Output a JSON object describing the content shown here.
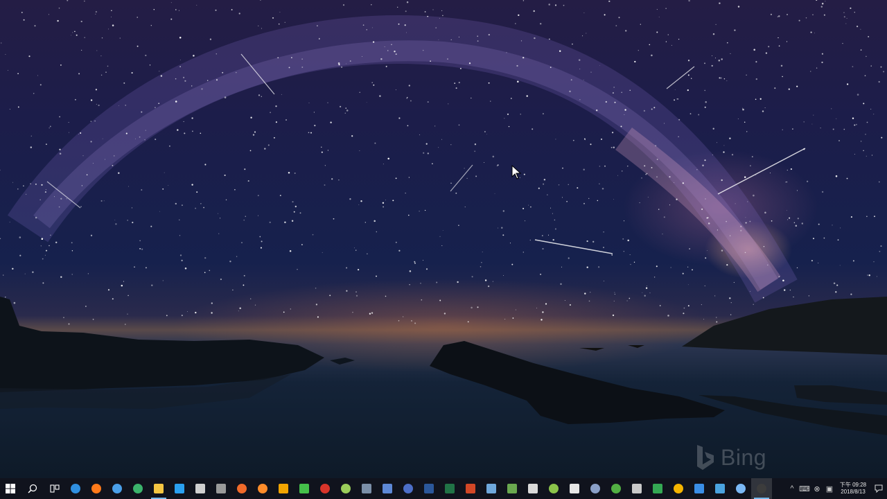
{
  "wallpaper": {
    "description_name": "milky-way-over-sea-wallpaper",
    "watermark_text": "Bing"
  },
  "taskbar": {
    "start": "start-icon",
    "search": "search-icon",
    "task_view": "task-view-icon",
    "apps": [
      {
        "name": "edge-icon",
        "color": "#2f8fe0",
        "shape": "round",
        "running": false
      },
      {
        "name": "firefox-icon",
        "color": "#ff7a1a",
        "shape": "round",
        "running": false
      },
      {
        "name": "chrome-icon",
        "color": "#4a9fe8",
        "shape": "round",
        "running": false
      },
      {
        "name": "colorful-app-icon",
        "color": "#3bb36b",
        "shape": "round",
        "running": false
      },
      {
        "name": "file-explorer-icon",
        "color": "#f4c542",
        "shape": "square",
        "running": true
      },
      {
        "name": "media-player-icon",
        "color": "#2aa0f0",
        "shape": "square",
        "running": false
      },
      {
        "name": "video-editor-icon",
        "color": "#cfcfcf",
        "shape": "square",
        "running": false
      },
      {
        "name": "clapper-icon",
        "color": "#9a9a9a",
        "shape": "square",
        "running": false
      },
      {
        "name": "orange-app-icon",
        "color": "#f06a2a",
        "shape": "round",
        "running": false
      },
      {
        "name": "paint-app-icon",
        "color": "#ff8c2a",
        "shape": "round",
        "running": false
      },
      {
        "name": "yellow-app-icon",
        "color": "#f2a400",
        "shape": "square",
        "running": false
      },
      {
        "name": "notepad-plus-icon",
        "color": "#44c04a",
        "shape": "square",
        "running": false
      },
      {
        "name": "red-circle-icon",
        "color": "#d8342a",
        "shape": "round",
        "running": false
      },
      {
        "name": "green-leaf-icon",
        "color": "#9acd5a",
        "shape": "round",
        "running": false
      },
      {
        "name": "tools-icon",
        "color": "#7b8fa8",
        "shape": "square",
        "running": false
      },
      {
        "name": "remote-desktop-icon",
        "color": "#5d88d6",
        "shape": "square",
        "running": false
      },
      {
        "name": "globe-app-icon",
        "color": "#4c6ec8",
        "shape": "round",
        "running": false
      },
      {
        "name": "word-icon",
        "color": "#2b579a",
        "shape": "square",
        "running": false
      },
      {
        "name": "excel-icon",
        "color": "#217346",
        "shape": "square",
        "running": false
      },
      {
        "name": "powerpoint-icon",
        "color": "#d24726",
        "shape": "square",
        "running": false
      },
      {
        "name": "blue-document-icon",
        "color": "#6fa8dc",
        "shape": "square",
        "running": false
      },
      {
        "name": "green-document-icon",
        "color": "#6aa84f",
        "shape": "square",
        "running": false
      },
      {
        "name": "calculator-icon",
        "color": "#d9d9d9",
        "shape": "square",
        "running": false
      },
      {
        "name": "green-yellow-app-icon",
        "color": "#8bc34a",
        "shape": "round",
        "running": false
      },
      {
        "name": "crossed-tools-icon",
        "color": "#e6e6e6",
        "shape": "square",
        "running": false
      },
      {
        "name": "circle-app-icon",
        "color": "#8aa0c8",
        "shape": "round",
        "running": false
      },
      {
        "name": "utorrent-icon",
        "color": "#52b043",
        "shape": "round",
        "running": false
      },
      {
        "name": "printer-app-icon",
        "color": "#c9c9c9",
        "shape": "square",
        "running": false
      },
      {
        "name": "google-drive-icon",
        "color": "#34a853",
        "shape": "square",
        "running": false
      },
      {
        "name": "chrome-remote-icon",
        "color": "#f4b400",
        "shape": "round",
        "running": false
      },
      {
        "name": "network-app-icon",
        "color": "#3a8ee6",
        "shape": "square",
        "running": false
      },
      {
        "name": "mail-app-icon",
        "color": "#4aa3df",
        "shape": "square",
        "running": false
      },
      {
        "name": "blue-ball-icon",
        "color": "#7ab8f5",
        "shape": "round",
        "running": false
      },
      {
        "name": "obs-studio-icon",
        "color": "#3c3c3c",
        "shape": "round",
        "running": true,
        "active": true
      }
    ],
    "tray": {
      "chevron": "^",
      "keyboard": "⌨",
      "close_symbol": "⊗",
      "battery_box": "▣",
      "time": "下午 09:28",
      "date": "2018/8/13"
    },
    "notification": "notification-icon"
  }
}
